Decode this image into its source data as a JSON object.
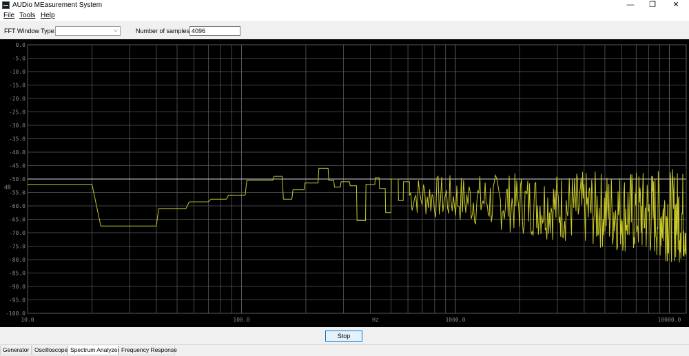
{
  "window": {
    "title": "AUDio MEasurement System",
    "minimize": "—",
    "maximize": "❐",
    "close": "✕"
  },
  "menu": {
    "file": "File",
    "tools": "Tools",
    "help": "Help"
  },
  "toolbar": {
    "fft_label": "FFT Window Type:",
    "fft_value": "",
    "samples_label": "Number of samples:",
    "samples_value": "4096"
  },
  "chart_data": {
    "type": "line",
    "title": "",
    "xlabel": "Hz",
    "ylabel": "dB",
    "xscale": "log",
    "xlim": [
      10,
      12000
    ],
    "ylim": [
      -100,
      0
    ],
    "xticks": [
      "10.0",
      "100.0",
      "1000.0",
      "10000.0"
    ],
    "yticks": [
      "0.0",
      "-5.0",
      "-10.0",
      "-15.0",
      "-20.0",
      "-25.0",
      "-30.0",
      "-35.0",
      "-40.0",
      "-45.0",
      "-50.0",
      "-55.0",
      "-60.0",
      "-65.0",
      "-70.0",
      "-75.0",
      "-80.0",
      "-85.0",
      "-90.0",
      "-95.0",
      "-100.0"
    ],
    "reference_line_db": -50,
    "grid": true,
    "colors": {
      "background": "#000000",
      "grid": "#5a5a5a",
      "signal": "#c8c82a",
      "reference": "#d8d8d8",
      "axis_text": "#8a8a8a"
    },
    "series": [
      {
        "steps": [
          [
            10,
            -52
          ],
          [
            20,
            -52
          ],
          [
            22,
            -67.5
          ],
          [
            40,
            -67.5
          ],
          [
            41,
            -61
          ],
          [
            55,
            -61
          ],
          [
            57,
            -58.5
          ],
          [
            70,
            -58.5
          ],
          [
            72,
            -57.5
          ],
          [
            85,
            -57.5
          ],
          [
            87,
            -56
          ],
          [
            104,
            -56
          ],
          [
            106,
            -50.5
          ],
          [
            140,
            -50.5
          ],
          [
            142,
            -49
          ],
          [
            155,
            -49
          ],
          [
            157,
            -57.5
          ],
          [
            172,
            -57.5
          ],
          [
            174,
            -54
          ],
          [
            196,
            -54
          ],
          [
            198,
            -51.5
          ],
          [
            228,
            -51.5
          ],
          [
            230,
            -46
          ],
          [
            254,
            -46
          ],
          [
            256,
            -50.5
          ],
          [
            270,
            -50.5
          ],
          [
            272,
            -53
          ],
          [
            290,
            -53
          ],
          [
            292,
            -51
          ],
          [
            320,
            -51
          ],
          [
            322,
            -52.5
          ],
          [
            345,
            -52.5
          ],
          [
            347,
            -65.5
          ],
          [
            380,
            -65.5
          ],
          [
            382,
            -52
          ],
          [
            420,
            -52
          ],
          [
            422,
            -49.5
          ],
          [
            440,
            -49.5
          ],
          [
            442,
            -53.5
          ],
          [
            470,
            -53.5
          ],
          [
            472,
            -62.5
          ],
          [
            500,
            -62.5
          ],
          [
            502,
            -50
          ],
          [
            540,
            -50
          ],
          [
            542,
            -58
          ],
          [
            570,
            -58
          ],
          [
            572,
            -51
          ],
          [
            610,
            -51
          ]
        ]
      },
      {
        "noisy_from_hz": 610,
        "noisy_to_hz": 12000,
        "center_db": -56,
        "spread_db": 12
      }
    ]
  },
  "buttons": {
    "stop": "Stop"
  },
  "tabs": [
    "Generator",
    "Oscilloscope",
    "Spectrum Analyzer",
    "Frequency Response"
  ],
  "active_tab": 2
}
